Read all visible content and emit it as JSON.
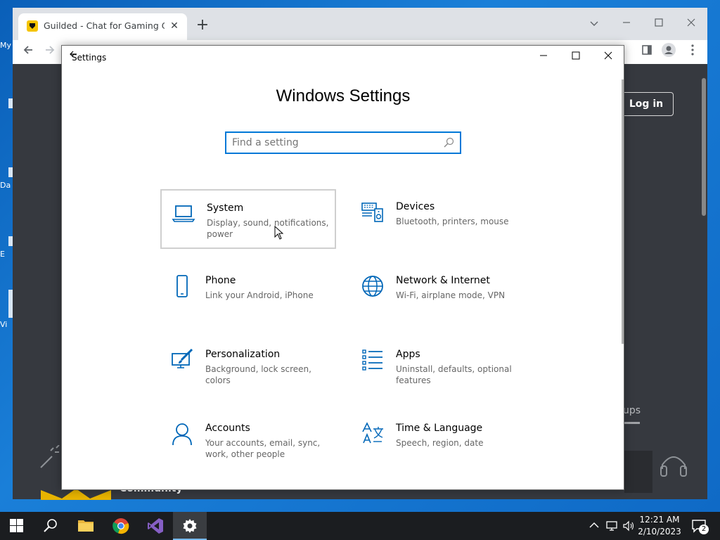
{
  "desktop": {
    "icon_labels": [
      "My",
      "Da",
      "E",
      "Vi"
    ]
  },
  "browser": {
    "tab_title": "Guilded - Chat for Gaming Communities",
    "tab_close": "✕",
    "new_tab": "+",
    "page": {
      "login_label": "Log in",
      "partial_text": "ups",
      "community_label": "Community"
    }
  },
  "settings": {
    "window_title": "Settings",
    "heading": "Windows Settings",
    "search_placeholder": "Find a setting",
    "accent_color": "#0078d7",
    "tiles": [
      {
        "title": "System",
        "description": "Display, sound, notifications, power",
        "icon": "laptop-icon"
      },
      {
        "title": "Devices",
        "description": "Bluetooth, printers, mouse",
        "icon": "keyboard-speaker-icon"
      },
      {
        "title": "Phone",
        "description": "Link your Android, iPhone",
        "icon": "phone-icon"
      },
      {
        "title": "Network & Internet",
        "description": "Wi-Fi, airplane mode, VPN",
        "icon": "globe-icon"
      },
      {
        "title": "Personalization",
        "description": "Background, lock screen, colors",
        "icon": "paint-brush-icon"
      },
      {
        "title": "Apps",
        "description": "Uninstall, defaults, optional features",
        "icon": "apps-list-icon"
      },
      {
        "title": "Accounts",
        "description": "Your accounts, email, sync, work, other people",
        "icon": "person-icon"
      },
      {
        "title": "Time & Language",
        "description": "Speech, region, date",
        "icon": "time-language-icon"
      }
    ]
  },
  "taskbar": {
    "time": "12:21 AM",
    "date": "2/10/2023",
    "notification_count": "2"
  }
}
